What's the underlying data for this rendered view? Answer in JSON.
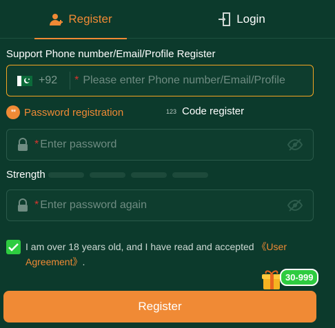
{
  "tabs": {
    "register": "Register",
    "login": "Login"
  },
  "section_title": "Support Phone number/Email/Profile Register",
  "phone": {
    "country_code": "+92",
    "required_mark": "*",
    "placeholder": "Please enter Phone number/Email/Profile"
  },
  "modes": {
    "password_label": "Password registration",
    "password_dot": "**",
    "code_number": "123",
    "code_label": "Code register"
  },
  "password": {
    "required_mark": "*",
    "placeholder": "Enter password"
  },
  "strength": {
    "label": "Strength",
    "level": 0
  },
  "confirm": {
    "required_mark": "*",
    "placeholder": "Enter password again"
  },
  "agreement": {
    "checked": true,
    "text": "I am over 18 years old, and I have read and accepted ",
    "link": "《User Agreement》",
    "suffix": "."
  },
  "promo": {
    "badge": "30-999"
  },
  "submit_label": "Register",
  "colors": {
    "accent": "#f08a35",
    "background": "#0c3a2c",
    "check": "#2ecc40",
    "required": "#d9352e"
  },
  "icons": [
    "add-user-icon",
    "login-icon",
    "pakistan-flag-icon",
    "lock-icon",
    "eye-off-icon",
    "check-icon",
    "gift-icon"
  ]
}
